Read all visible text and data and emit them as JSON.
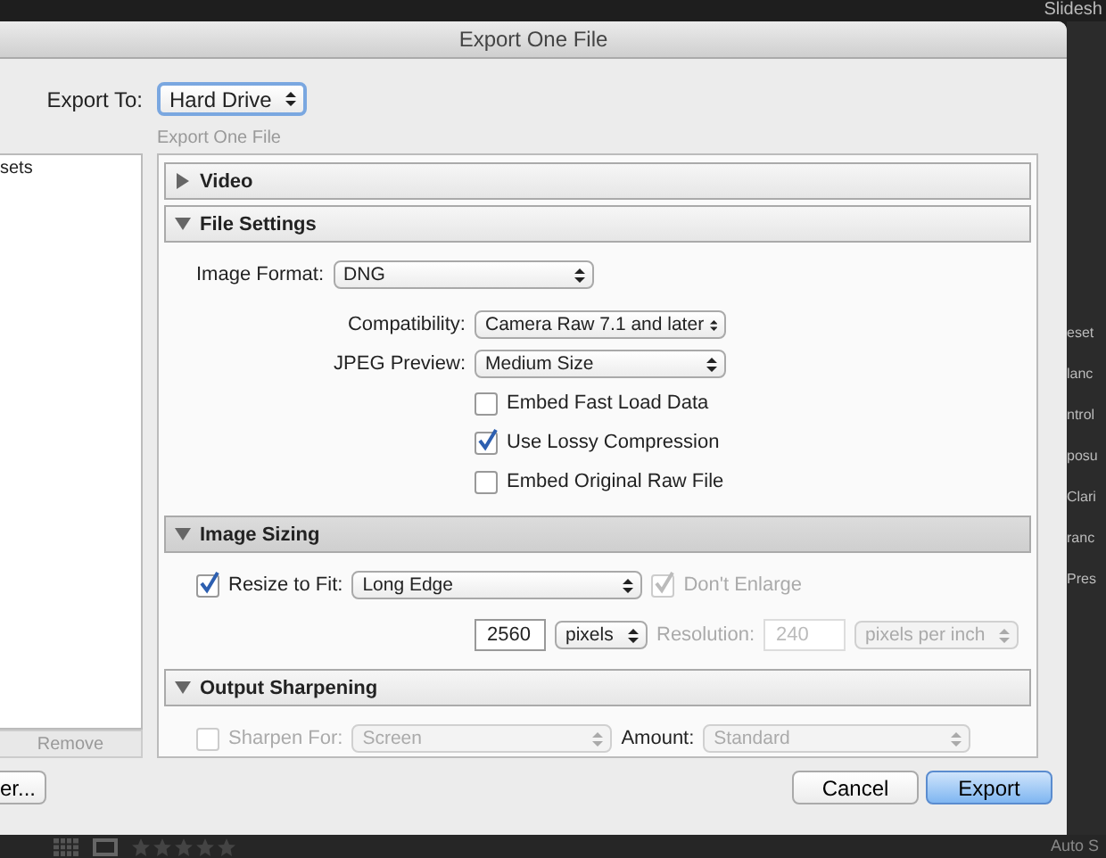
{
  "background": {
    "top_tab": "Slidesh",
    "side_labels": [
      "eset",
      "lanc",
      "ntrol",
      "posu",
      "Clari",
      "ranc",
      "Pres"
    ],
    "bottom_label": "Auto S"
  },
  "window": {
    "title": "Export One File"
  },
  "export_to": {
    "label": "Export To:",
    "value": "Hard Drive"
  },
  "subtitle": "Export One File",
  "presets": {
    "items": [
      "sets"
    ],
    "remove_button": "Remove",
    "bottom_button": "er..."
  },
  "sections": [
    {
      "title": "Video",
      "expanded": false,
      "highlighted": false
    },
    {
      "title": "File Settings",
      "expanded": true,
      "highlighted": false,
      "rows": [
        {
          "kind": "main",
          "controls": [
            {
              "kind": "label",
              "text": "Image Format:",
              "disabled": false
            },
            {
              "kind": "select",
              "value": "DNG",
              "disabled": false
            }
          ]
        },
        {
          "kind": "sub",
          "controls": [
            {
              "kind": "label",
              "text": "Compatibility:",
              "disabled": false
            },
            {
              "kind": "select",
              "value": "Camera Raw 7.1 and later",
              "disabled": false
            }
          ]
        },
        {
          "kind": "sub",
          "controls": [
            {
              "kind": "label",
              "text": "JPEG Preview:",
              "disabled": false
            },
            {
              "kind": "select",
              "value": "Medium Size",
              "disabled": false
            }
          ]
        },
        {
          "kind": "sub",
          "controls": [
            {
              "kind": "checkbox",
              "label": "Embed Fast Load Data",
              "checked": false,
              "disabled": false
            }
          ]
        },
        {
          "kind": "sub",
          "controls": [
            {
              "kind": "checkbox",
              "label": "Use Lossy Compression",
              "checked": true,
              "disabled": false
            }
          ]
        },
        {
          "kind": "sub",
          "controls": [
            {
              "kind": "checkbox",
              "label": "Embed Original Raw File",
              "checked": false,
              "disabled": false
            }
          ]
        }
      ]
    },
    {
      "title": "Image Sizing",
      "expanded": true,
      "highlighted": true,
      "rows": [
        {
          "kind": "main",
          "controls": [
            {
              "kind": "checkbox",
              "label": "Resize to Fit:",
              "checked": true,
              "disabled": false
            },
            {
              "kind": "select",
              "value": "Long Edge",
              "disabled": false
            },
            {
              "kind": "checkbox",
              "label": "Don't Enlarge",
              "checked": true,
              "disabled": true
            }
          ]
        },
        {
          "kind": "sub",
          "controls": [
            {
              "kind": "input",
              "value": "2560",
              "disabled": false
            },
            {
              "kind": "select",
              "value": "pixels",
              "disabled": false
            },
            {
              "kind": "label",
              "text": "Resolution:",
              "disabled": true
            },
            {
              "kind": "input",
              "value": "240",
              "disabled": true
            },
            {
              "kind": "select",
              "value": "pixels per inch",
              "disabled": true
            }
          ]
        }
      ]
    },
    {
      "title": "Output Sharpening",
      "expanded": true,
      "highlighted": false,
      "rows": [
        {
          "kind": "main",
          "controls": [
            {
              "kind": "checkbox",
              "label": "Sharpen For:",
              "checked": false,
              "disabled": true
            },
            {
              "kind": "select",
              "value": "Screen",
              "disabled": true
            },
            {
              "kind": "label",
              "text": "Amount:",
              "disabled": false
            },
            {
              "kind": "select",
              "value": "Standard",
              "disabled": true
            }
          ]
        }
      ]
    }
  ],
  "buttons": [
    {
      "label": "Cancel",
      "default": false
    },
    {
      "label": "Export",
      "default": true
    }
  ]
}
